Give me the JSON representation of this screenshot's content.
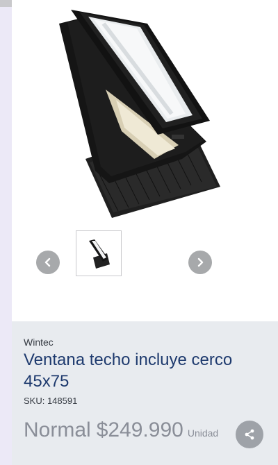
{
  "gallery": {
    "main_image_icon": "roof-window-product-image",
    "thumbnail_icon": "roof-window-thumbnail",
    "prev_icon": "chevron-left-icon",
    "next_icon": "chevron-right-icon"
  },
  "product": {
    "brand": "Wintec",
    "title": "Ventana techo incluye cerco 45x75",
    "sku": "SKU: 148591",
    "price_label": "Normal",
    "price_value": "$249.990",
    "price_unit": "Unidad"
  },
  "actions": {
    "share_icon": "share-icon"
  },
  "colors": {
    "title": "#1e3a6e",
    "info_background": "#e8ebef",
    "nav_button": "#a7a9ab",
    "price_text": "#8a8e98"
  }
}
